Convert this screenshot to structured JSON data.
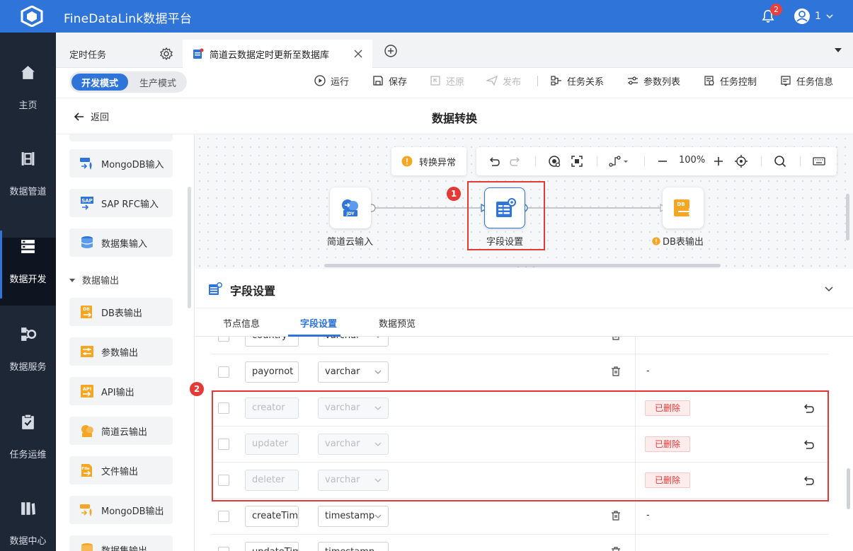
{
  "app": {
    "title": "FineDataLink数据平台",
    "notification_count": "2",
    "user_name": "1"
  },
  "nav": [
    {
      "label": "主页",
      "icon": "home-icon"
    },
    {
      "label": "数据管道",
      "icon": "pipeline-icon"
    },
    {
      "label": "数据开发",
      "icon": "data-dev-icon",
      "active": true
    },
    {
      "label": "数据服务",
      "icon": "data-service-icon"
    },
    {
      "label": "任务运维",
      "icon": "task-ops-icon"
    },
    {
      "label": "数据中心",
      "icon": "data-center-icon"
    }
  ],
  "tabs": [
    {
      "label": "定时任务"
    },
    {
      "label": "简道云数据定时更新至数据库",
      "active": true
    }
  ],
  "toolbar": {
    "mode_dev": "开发模式",
    "mode_prod": "生产模式",
    "run": "运行",
    "save": "保存",
    "restore": "还原",
    "publish": "发布",
    "task_relation": "任务关系",
    "param_list": "参数列表",
    "task_control": "任务控制",
    "task_info": "任务信息"
  },
  "page": {
    "back": "返回",
    "title": "数据转换"
  },
  "components": {
    "items_top": [
      "MongoDB输入",
      "SAP RFC输入",
      "数据集输入"
    ],
    "group": "数据输出",
    "items_out": [
      "DB表输出",
      "参数输出",
      "API输出",
      "简道云输出",
      "文件输出",
      "MongoDB输出",
      "数据集输出"
    ]
  },
  "canvas": {
    "error_label": "转换异常",
    "zoom": "100%",
    "nodes": [
      {
        "label": "简道云输入",
        "icon": "jiandaoyun-input-icon"
      },
      {
        "label": "字段设置",
        "icon": "field-settings-icon",
        "selected": true
      },
      {
        "label": "DB表输出",
        "icon": "db-output-icon",
        "warning": true
      }
    ],
    "node_icon_text": {
      "jdy": "JDY",
      "db": "DB"
    },
    "markers": [
      "1",
      "2"
    ]
  },
  "panel": {
    "title": "字段设置",
    "tabs": [
      "节点信息",
      "字段设置",
      "数据预览"
    ],
    "active_tab": "字段设置",
    "deleted_label": "已删除",
    "rows": [
      {
        "name": "country",
        "type": "varchar",
        "status": "normal",
        "note": ""
      },
      {
        "name": "payornot",
        "type": "varchar",
        "status": "normal",
        "note": "-"
      },
      {
        "name": "creator",
        "type": "varchar",
        "status": "deleted",
        "note": ""
      },
      {
        "name": "updater",
        "type": "varchar",
        "status": "deleted",
        "note": ""
      },
      {
        "name": "deleter",
        "type": "varchar",
        "status": "deleted",
        "note": ""
      },
      {
        "name": "createTim",
        "type": "timestamp",
        "status": "normal",
        "note": "-"
      },
      {
        "name": "updateTim",
        "type": "timestamp",
        "status": "normal",
        "note": ""
      }
    ]
  },
  "colors": {
    "primary": "#2f74d8",
    "nav_bg": "#1e2735",
    "danger": "#e53935",
    "warning": "#f5a623"
  }
}
